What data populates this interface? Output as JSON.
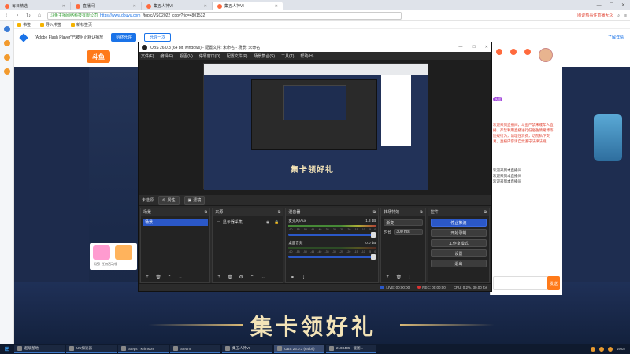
{
  "browser": {
    "tabs": [
      {
        "label": "每日精选",
        "active": false
      },
      {
        "label": "直播间",
        "active": false
      },
      {
        "label": "集五人神VI",
        "active": false
      },
      {
        "label": "集五人神VI",
        "active": true
      }
    ],
    "url": {
      "secure_label": "斗鱼主播网络科技有限公司",
      "host": "https://www.douyu.com",
      "path": "/topic/VSC2022_copy?rid=4801532"
    },
    "addr_right": {
      "hot": "图说热事件直播大众",
      "search": "搜索"
    },
    "bookmarks": [
      "书签",
      "导入书签",
      "新标签页"
    ]
  },
  "flash": {
    "message": "\"Adobe Flash Player\"已被阻止默认播放",
    "allow_label": "始终允许",
    "once_label": "允许一次",
    "right_label": "了解详情"
  },
  "douyu": {
    "logo": "斗鱼",
    "banner": "集卡领好礼",
    "gift_text": "【活】任何活动领",
    "chat": {
      "badge1": "欢迎",
      "msgs": [
        "欢迎来到直播间，斗鱼严禁未成年人直",
        "播、严禁利用直播进行低俗色情赌博等",
        "违规行为，请理性消费，切勿私下交",
        "易。直播内容请自觉遵守法律法规"
      ],
      "msgs_dark": [
        "欢迎来到本直播间",
        "欢迎来到本直播间",
        "欢迎来到本直播间"
      ],
      "send": "发送"
    }
  },
  "obs": {
    "title": "OBS 26.0.3 (64 bit, windows) - 配置文件: 未命名 - 场景: 未命名",
    "menu": [
      "文件(F)",
      "编辑(E)",
      "视图(V)",
      "停靠窗口(D)",
      "配置文件(P)",
      "场景集合(S)",
      "工具(T)",
      "帮助(H)"
    ],
    "preview_banner": "集卡领好礼",
    "srcbar": {
      "label": "未选源",
      "props": "属性",
      "filters": "滤镜"
    },
    "docks": {
      "scenes": {
        "title": "场景",
        "items": [
          "场景"
        ]
      },
      "sources": {
        "title": "来源",
        "items": [
          "显示器采集"
        ]
      },
      "mixer": {
        "title": "混音器",
        "channels": [
          {
            "name": "麦克风/Aux",
            "db": "-1.8 dB"
          },
          {
            "name": "桌面音频",
            "db": "0.0 dB"
          }
        ],
        "ticks": [
          "-60",
          "-55",
          "-50",
          "-45",
          "-40",
          "-35",
          "-30",
          "-25",
          "-20",
          "-15",
          "-10",
          "-5",
          "0"
        ]
      },
      "transitions": {
        "title": "转场特效",
        "type": "渐变",
        "duration_label": "时长",
        "duration": "300 ms"
      },
      "controls": {
        "title": "控件",
        "buttons": [
          "停止推流",
          "开始录制",
          "工作室模式",
          "设置",
          "退出"
        ]
      }
    },
    "status": {
      "live": "LIVE: 00:00:00",
      "rec": "REC: 00:00:00",
      "cpu": "CPU: 0.2%, 30.00 fps"
    }
  },
  "taskbar": {
    "items": [
      {
        "label": "超级基地",
        "active": false
      },
      {
        "label": "UU加速器",
        "active": false
      },
      {
        "label": "Steps - Krimsom",
        "active": false
      },
      {
        "label": "Steam",
        "active": false
      },
      {
        "label": "集五人神VI",
        "active": false
      },
      {
        "label": "OBS 26.0.3 (64 bit)",
        "active": true
      },
      {
        "label": "2103495 - 截图...",
        "active": false
      }
    ],
    "time": "19:02"
  },
  "colors": {
    "accent": "#2b58c8",
    "brand": "#ff7a1a",
    "banner_text": "#f3e3b7"
  }
}
